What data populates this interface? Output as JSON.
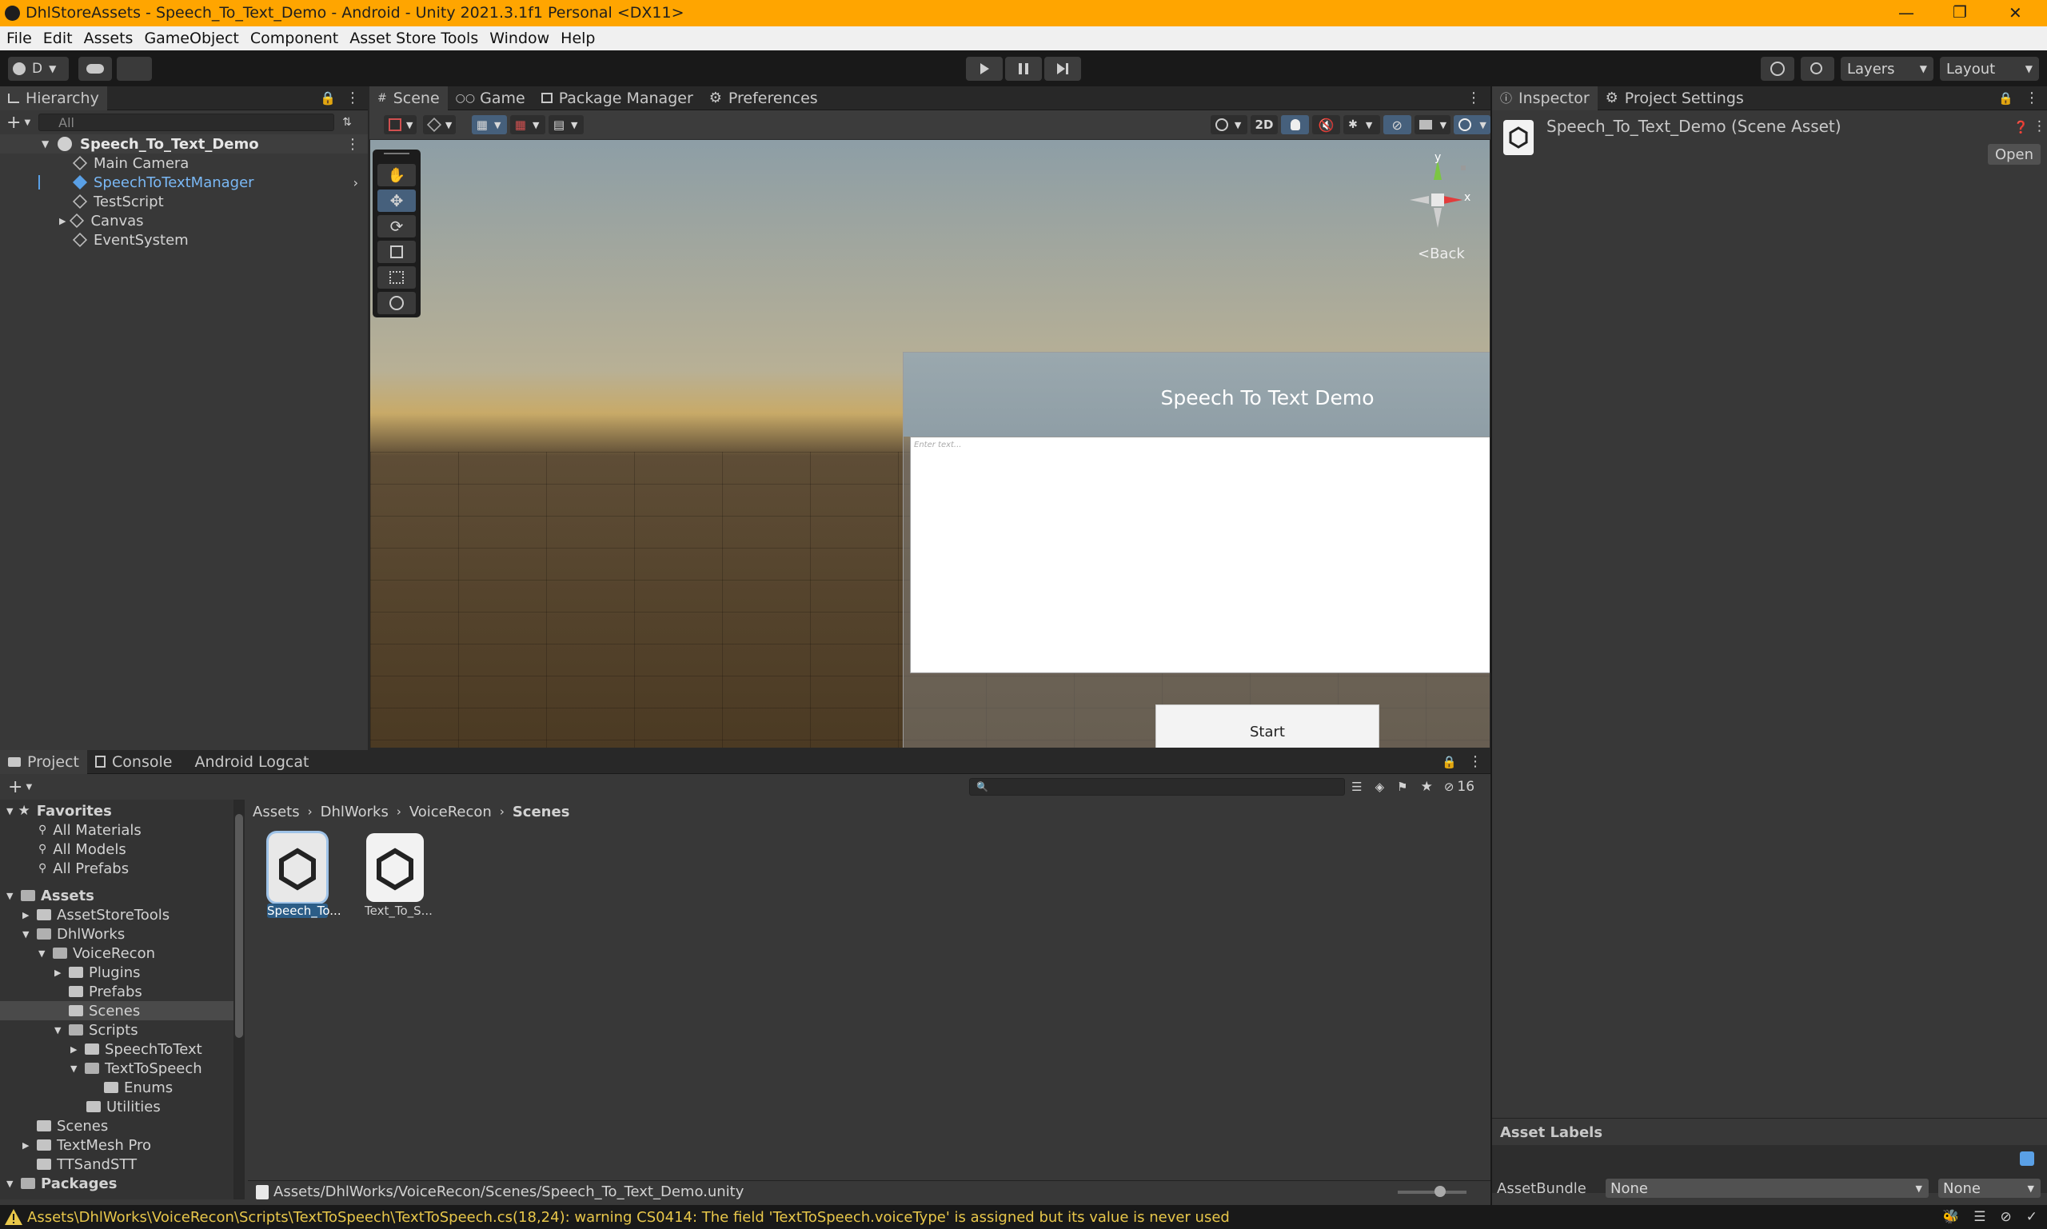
{
  "window": {
    "title": "DhlStoreAssets - Speech_To_Text_Demo - Android - Unity 2021.3.1f1 Personal <DX11>"
  },
  "menu": [
    "File",
    "Edit",
    "Assets",
    "GameObject",
    "Component",
    "Asset Store Tools",
    "Window",
    "Help"
  ],
  "toolbar": {
    "account_label": "D",
    "layers_label": "Layers",
    "layout_label": "Layout"
  },
  "hierarchy": {
    "tab": "Hierarchy",
    "search_placeholder": "All",
    "scene": "Speech_To_Text_Demo",
    "items": [
      "Main Camera",
      "SpeechToTextManager",
      "TestScript",
      "Canvas",
      "EventSystem"
    ]
  },
  "scene": {
    "tabs": [
      "Scene",
      "Game",
      "Package Manager",
      "Preferences"
    ],
    "mode_2d": "2D",
    "gizmo": {
      "y": "y",
      "x": "x",
      "back": "<Back"
    },
    "canvas": {
      "title": "Speech To Text Demo",
      "placeholder": "Enter text...",
      "button": "Start"
    }
  },
  "inspector": {
    "tabs": [
      "Inspector",
      "Project Settings"
    ],
    "asset_name": "Speech_To_Text_Demo (Scene Asset)",
    "open_button": "Open",
    "asset_labels": "Asset Labels",
    "asset_bundle_label": "AssetBundle",
    "asset_bundle_value": "None",
    "asset_variant_value": "None"
  },
  "project": {
    "tabs": [
      "Project",
      "Console",
      "Android Logcat"
    ],
    "hidden_count": "16",
    "favorites": {
      "label": "Favorites",
      "items": [
        "All Materials",
        "All Models",
        "All Prefabs"
      ]
    },
    "tree": [
      {
        "label": "Assets",
        "depth": 0
      },
      {
        "label": "AssetStoreTools",
        "depth": 1
      },
      {
        "label": "DhlWorks",
        "depth": 1
      },
      {
        "label": "VoiceRecon",
        "depth": 2
      },
      {
        "label": "Plugins",
        "depth": 3
      },
      {
        "label": "Prefabs",
        "depth": 3
      },
      {
        "label": "Scenes",
        "depth": 3
      },
      {
        "label": "Scripts",
        "depth": 3
      },
      {
        "label": "SpeechToText",
        "depth": 4
      },
      {
        "label": "TextToSpeech",
        "depth": 4
      },
      {
        "label": "Enums",
        "depth": 5
      },
      {
        "label": "Utilities",
        "depth": 4
      },
      {
        "label": "Scenes",
        "depth": 1
      },
      {
        "label": "TextMesh Pro",
        "depth": 1
      },
      {
        "label": "TTSandSTT",
        "depth": 1
      },
      {
        "label": "Packages",
        "depth": 0
      }
    ],
    "breadcrumb": [
      "Assets",
      "DhlWorks",
      "VoiceRecon",
      "Scenes"
    ],
    "files": [
      "Speech_To...",
      "Text_To_S..."
    ],
    "selected_path": "Assets/DhlWorks/VoiceRecon/Scenes/Speech_To_Text_Demo.unity"
  },
  "status": {
    "message": "Assets\\DhlWorks\\VoiceRecon\\Scripts\\TextToSpeech\\TextToSpeech.cs(18,24): warning CS0414: The field 'TextToSpeech.voiceType' is assigned but its value is never used"
  },
  "colors": {
    "title_bar": "#FFA500",
    "selection": "#2c5d87",
    "warning": "#e8c74a"
  }
}
